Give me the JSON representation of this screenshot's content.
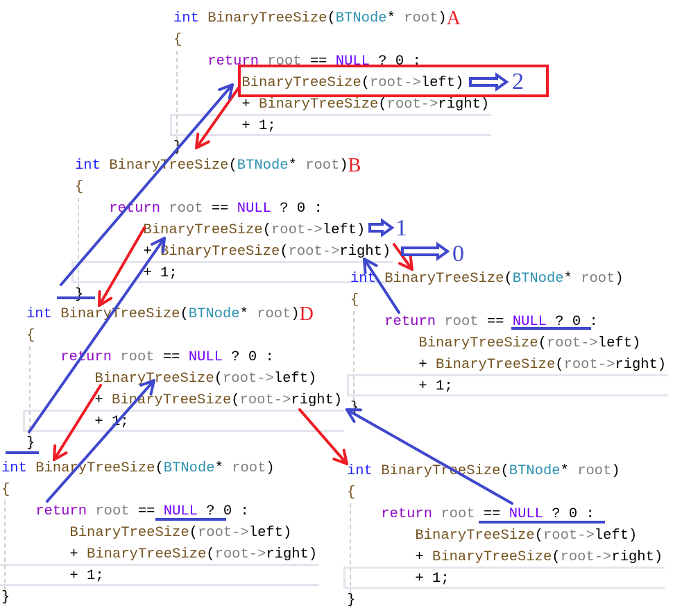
{
  "colors": {
    "keyword": "#1f1fff",
    "function": "#74531f",
    "type": "#2b91af",
    "param": "#808080",
    "control": "#8f08c4",
    "macro": "#6f00ff",
    "plain": "#000000",
    "annotation_red": "#ee1c25",
    "annotation_blue": "#3f48cc",
    "highlight": "#e4e4ee"
  },
  "code": {
    "header": [
      [
        "int",
        "keyword"
      ],
      [
        " ",
        "plain"
      ],
      [
        "BinaryTreeSize",
        "function"
      ],
      [
        "(",
        "plain"
      ],
      [
        "BTNode",
        "type"
      ],
      [
        "* ",
        "plain"
      ],
      [
        "root",
        "param"
      ],
      [
        ")",
        "plain"
      ]
    ],
    "open": [
      [
        "{",
        "function"
      ]
    ],
    "ret": [
      [
        "    ",
        "plain"
      ],
      [
        "return",
        "control"
      ],
      [
        " ",
        "plain"
      ],
      [
        "root",
        "param"
      ],
      [
        " == ",
        "plain"
      ],
      [
        "NULL",
        "macro"
      ],
      [
        " ? 0 :",
        "plain"
      ]
    ],
    "left": [
      [
        "        ",
        "plain"
      ],
      [
        "BinaryTreeSize",
        "function"
      ],
      [
        "(",
        "plain"
      ],
      [
        "root",
        "param"
      ],
      [
        "->",
        "param"
      ],
      [
        "left",
        "plain"
      ],
      [
        ")",
        "plain"
      ]
    ],
    "right": [
      [
        "        + ",
        "plain"
      ],
      [
        "BinaryTreeSize",
        "function"
      ],
      [
        "(",
        "plain"
      ],
      [
        "root",
        "param"
      ],
      [
        "->",
        "param"
      ],
      [
        "right",
        "plain"
      ],
      [
        ")",
        "plain"
      ]
    ],
    "plus": [
      [
        "        + 1;",
        "plain"
      ]
    ],
    "close": [
      [
        "}",
        "plain"
      ]
    ]
  },
  "blocks": [
    {
      "label": "A"
    },
    {
      "label": "B"
    },
    {
      "label": ""
    },
    {
      "label": "D"
    },
    {
      "label": ""
    },
    {
      "label": ""
    }
  ],
  "annotations": {
    "result_A": "2",
    "result_B_left": "1",
    "result_B_right": "0"
  }
}
